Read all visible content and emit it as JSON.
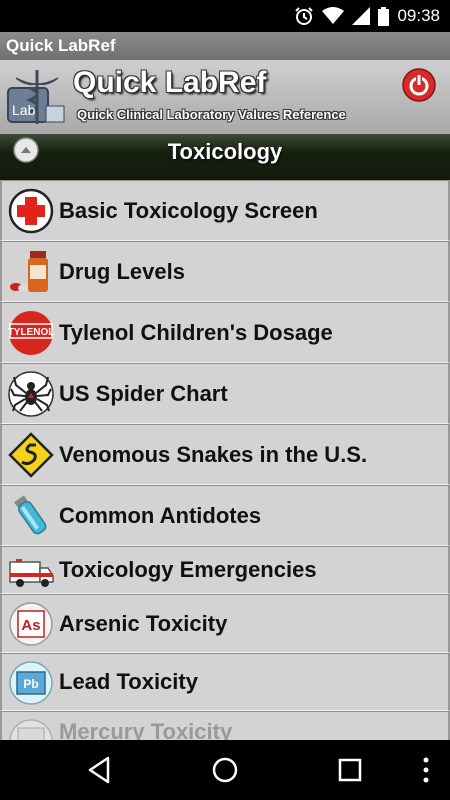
{
  "status_bar": {
    "time": "09:38",
    "icons": [
      "alarm-icon",
      "wifi-icon",
      "signal-icon",
      "battery-icon"
    ]
  },
  "title_bar": {
    "title": "Quick LabRef"
  },
  "header": {
    "app_name": "Quick LabRef",
    "subtitle": "Quick Clinical Laboratory Values Reference",
    "logo_text": "Lab"
  },
  "section": {
    "title": "Toxicology"
  },
  "items": [
    {
      "label": "Basic Toxicology Screen",
      "icon": "red-cross-icon"
    },
    {
      "label": "Drug Levels",
      "icon": "medicine-bottle-icon"
    },
    {
      "label": "Tylenol Children's Dosage",
      "icon": "tylenol-logo-icon",
      "icon_text": "TYLENOL"
    },
    {
      "label": "US Spider Chart",
      "icon": "spider-icon"
    },
    {
      "label": "Venomous Snakes in the U.S.",
      "icon": "snake-sign-icon"
    },
    {
      "label": "Common Antidotes",
      "icon": "vial-icon"
    },
    {
      "label": "Toxicology Emergencies",
      "icon": "ambulance-icon"
    },
    {
      "label": "Arsenic Toxicity",
      "icon": "arsenic-element-icon",
      "icon_text": "As"
    },
    {
      "label": "Lead Toxicity",
      "icon": "lead-element-icon",
      "icon_text": "Pb"
    },
    {
      "label": "Mercury Toxicity",
      "icon": "mercury-element-icon"
    }
  ],
  "nav_bar": {
    "buttons": [
      "back-icon",
      "home-icon",
      "recents-icon",
      "overflow-menu-icon"
    ]
  },
  "colors": {
    "section_bar": "#17200f",
    "list_bg": "#d3d3d3",
    "power": "#d62b2b",
    "cross": "#e2231a"
  }
}
